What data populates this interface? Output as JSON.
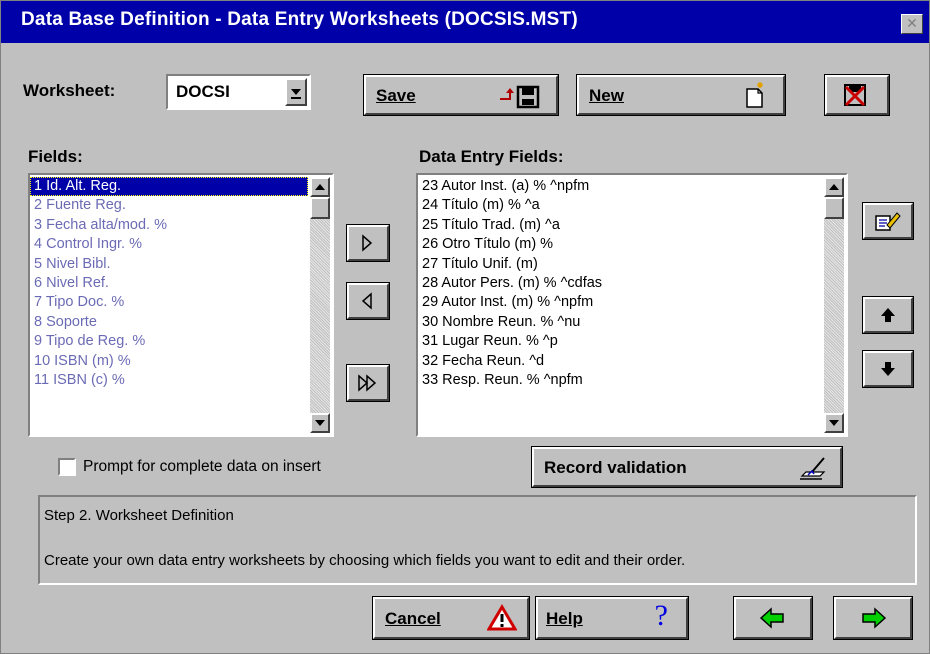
{
  "window": {
    "title": "Data Base Definition - Data Entry Worksheets (DOCSIS.MST)",
    "close_icon": "close-icon"
  },
  "worksheet": {
    "label": "Worksheet:",
    "value": "DOCSI"
  },
  "toolbar": {
    "save_label": "Save",
    "new_label": "New",
    "delete_icon": "delete-icon"
  },
  "fields": {
    "label": "Fields:",
    "items": [
      "1 Id. Alt. Reg.",
      "2 Fuente Reg.",
      "3 Fecha alta/mod. %",
      "4 Control Ingr. %",
      "5 Nivel Bibl.",
      "6 Nivel Ref.",
      "7 Tipo Doc. %",
      "8 Soporte",
      "9 Tipo de Reg. %",
      "10 ISBN (m) %",
      "11 ISBN (c) %"
    ],
    "selected_index": 0
  },
  "entry_fields": {
    "label": "Data Entry Fields:",
    "items": [
      "23 Autor Inst. (a) % ^npfm",
      "24 Título (m) % ^a",
      "25 Título Trad. (m) ^a",
      "26 Otro Título (m) %",
      "27 Título Unif. (m)",
      "28 Autor Pers. (m) % ^cdfas",
      "29 Autor Inst. (m) % ^npfm",
      "30 Nombre Reun. % ^nu",
      "31 Lugar Reun. % ^p",
      "32 Fecha Reun. ^d",
      "33 Resp. Reun. % ^npfm"
    ]
  },
  "prompt_checkbox": {
    "label": "Prompt for complete data on insert",
    "checked": false
  },
  "record_validation": {
    "label": "Record validation"
  },
  "status": {
    "line1": "Step 2. Worksheet Definition",
    "line2": "Create your own data entry worksheets by choosing which fields you want to edit and their order."
  },
  "footer": {
    "cancel_label": "Cancel",
    "help_label": "Help"
  },
  "colors": {
    "title_bar": "#0000a8",
    "selection": "#0000a8",
    "field_text": "#6b6bb5",
    "back_arrow": "#00c000"
  }
}
